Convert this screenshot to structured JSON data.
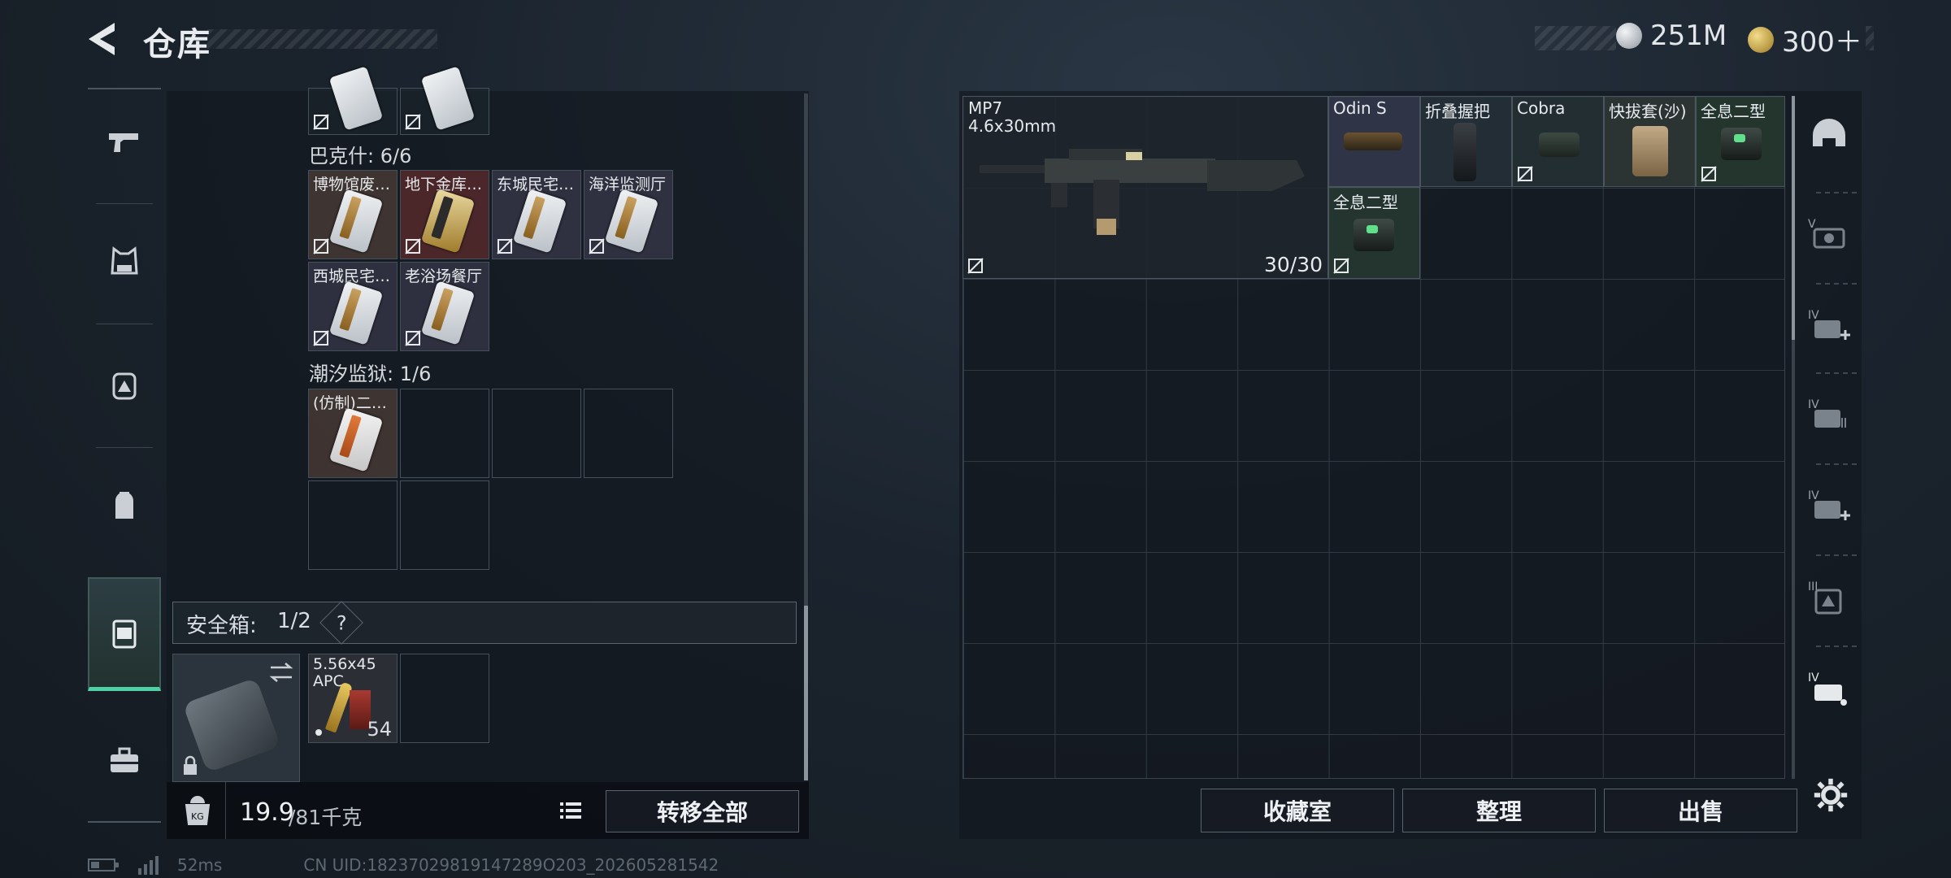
{
  "header": {
    "title": "仓库",
    "currency": [
      {
        "icon": "silver-coin-icon",
        "value": "251M"
      },
      {
        "icon": "gold-triangle-coin-icon",
        "value": "300＋"
      }
    ]
  },
  "left_nav": [
    {
      "icon": "pistol-icon"
    },
    {
      "icon": "armor-vest-icon"
    },
    {
      "icon": "tactical-backpack-icon"
    },
    {
      "icon": "backpack-icon"
    },
    {
      "icon": "safe-box-icon",
      "active": true
    },
    {
      "icon": "toolbox-icon"
    }
  ],
  "stash": {
    "top_items": [
      {
        "name": ""
      },
      {
        "name": ""
      }
    ],
    "section_bakeshi": {
      "label": "巴克什: 6/6",
      "items": [
        {
          "name": "博物馆废…",
          "card": "white"
        },
        {
          "name": "地下金库…",
          "card": "gold"
        },
        {
          "name": "东城民宅…",
          "card": "white"
        },
        {
          "name": "海洋监测厅",
          "card": "white"
        },
        {
          "name": "西城民宅…",
          "card": "white"
        },
        {
          "name": "老浴场餐厅",
          "card": "white"
        }
      ]
    },
    "section_chaoxi": {
      "label": "潮汐监狱: 1/6",
      "items": [
        {
          "name": "(仿制)二…"
        }
      ]
    }
  },
  "safe_box": {
    "label": "安全箱:",
    "count": "1/2",
    "help": "?",
    "ammo": {
      "name_line1": "5.56x45",
      "name_line2": "APC",
      "count": "54"
    }
  },
  "weight": {
    "current": "19.9",
    "max": "/81千克"
  },
  "buttons": {
    "transfer_all": "转移全部",
    "collection": "收藏室",
    "sort": "整理",
    "sell": "出售"
  },
  "weapon": {
    "name": "MP7",
    "caliber": "4.6x30mm",
    "ammo": "30/30",
    "attachments": [
      {
        "name": "Odin S"
      },
      {
        "name": "折叠握把"
      },
      {
        "name": "Cobra"
      },
      {
        "name": "快拔套(沙)"
      },
      {
        "name": "全息二型"
      },
      {
        "name": "全息二型"
      }
    ]
  },
  "right_nav": [
    {
      "icon": "helmet-icon"
    },
    {
      "icon": "armor-tier-v-icon"
    },
    {
      "icon": "backpack-tier-iv-add-icon"
    },
    {
      "icon": "backpack-tier-iv-icon"
    },
    {
      "icon": "chest-rig-tier-iv-add-icon"
    },
    {
      "icon": "container-tier-iii-icon"
    },
    {
      "icon": "container-tier-iv-icon"
    },
    {
      "icon": "settings-gear-icon"
    }
  ],
  "footer": {
    "ping": "52ms",
    "uid": "CN UID:18237029819147289O203_202605281542"
  }
}
